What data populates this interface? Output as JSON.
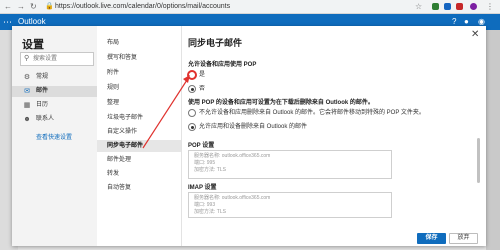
{
  "browser": {
    "url": "https://outlook.live.com/calendar/0/options/mail/accounts",
    "back_icon": "arrow-left-icon",
    "forward_icon": "arrow-right-icon",
    "reload_icon": "reload-icon"
  },
  "app": {
    "name": "Outlook"
  },
  "settings": {
    "title": "设置",
    "search_placeholder": "搜索设置",
    "nav": [
      {
        "label": "常规",
        "icon": "gear-icon"
      },
      {
        "label": "邮件",
        "icon": "mail-icon"
      },
      {
        "label": "日历",
        "icon": "calendar-icon"
      },
      {
        "label": "联系人",
        "icon": "people-icon"
      }
    ],
    "view_quick": "查看快速设置",
    "sub_nav": [
      "布局",
      "撰写和答复",
      "附件",
      "规则",
      "整理",
      "垃圾电子邮件",
      "自定义操作",
      "同步电子邮件",
      "邮件处理",
      "转发",
      "自动答复"
    ]
  },
  "content": {
    "title": "同步电子邮件",
    "pop_allow_heading": "允许设备和应用使用 POP",
    "yes_label": "是",
    "no_label": "否",
    "pop_delete_heading": "使用 POP 的设备和应用可设置为在下载后删除来自 Outlook 的邮件。",
    "delete_option_1": "不允许设备和应用删除来自 Outlook 的邮件。它会将邮件移动到特殊的 POP 文件夹。",
    "delete_option_2": "允许应用和设备删除来自 Outlook 的邮件",
    "pop_settings_heading": "POP 设置",
    "pop_server": "服务器名称: outlook.office365.com",
    "pop_port": "端口: 995",
    "pop_encryption": "加密方法: TLS",
    "imap_settings_heading": "IMAP 设置",
    "imap_server": "服务器名称: outlook.office365.com",
    "imap_port": "端口: 993",
    "imap_encryption": "加密方法: TLS",
    "save": "保存",
    "discard": "放弃"
  },
  "colors": {
    "brand": "#0f6cbd",
    "annotation": "#e0322e"
  }
}
